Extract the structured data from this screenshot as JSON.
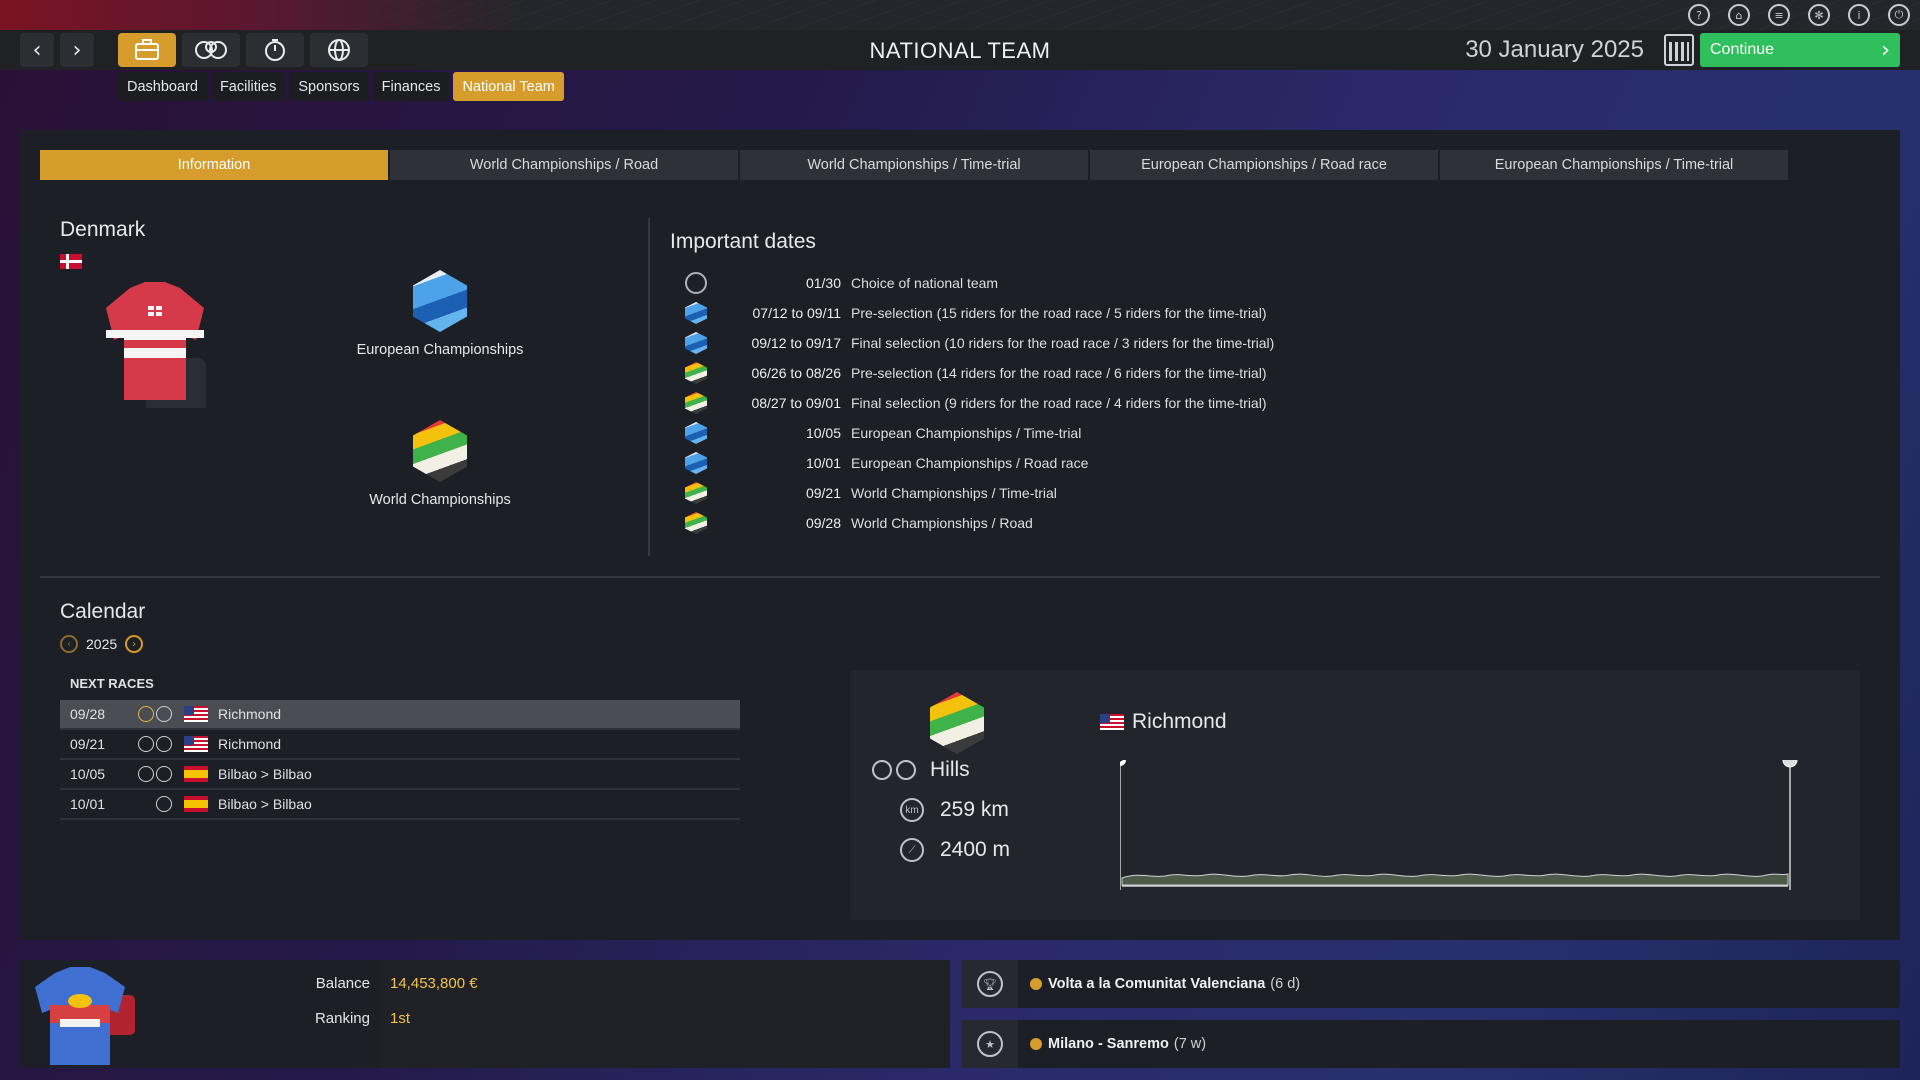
{
  "window": {
    "title": "NATIONAL TEAM",
    "date": "30 January 2025",
    "continue_label": "Continue"
  },
  "system_icons": [
    "help-icon",
    "home-icon",
    "menu-icon",
    "settings-icon",
    "info-icon",
    "power-icon"
  ],
  "nav_icons": [
    "back-arrow-icon",
    "forward-arrow-icon",
    "briefcase-icon",
    "team-icon",
    "stopwatch-icon",
    "globe-icon"
  ],
  "subtabs": [
    "Dashboard",
    "Facilities",
    "Sponsors",
    "Finances",
    "National Team"
  ],
  "active_subtab": "National Team",
  "content_tabs": [
    "Information",
    "World Championships / Road",
    "World Championships / Time-trial",
    "European Championships / Road race",
    "European Championships / Time-trial"
  ],
  "active_content_tab": "Information",
  "country": {
    "name": "Denmark"
  },
  "championships": {
    "european": "European Championships",
    "world": "World Championships"
  },
  "important_dates": {
    "title": "Important dates",
    "items": [
      {
        "icon": "clock",
        "date": "01/30",
        "label": "Choice of national team"
      },
      {
        "icon": "eu",
        "date": "07/12 to 09/11",
        "label": "Pre-selection (15 riders for the road race / 5 riders for the time-trial)"
      },
      {
        "icon": "eu",
        "date": "09/12 to 09/17",
        "label": "Final selection (10 riders for the road race / 3 riders for the time-trial)"
      },
      {
        "icon": "wc",
        "date": "06/26 to 08/26",
        "label": "Pre-selection (14 riders for the road race / 6 riders for the time-trial)"
      },
      {
        "icon": "wc",
        "date": "08/27 to 09/01",
        "label": "Final selection (9 riders for the road race / 4 riders for the time-trial)"
      },
      {
        "icon": "eu",
        "date": "10/05",
        "label": "European Championships / Time-trial"
      },
      {
        "icon": "eu",
        "date": "10/01",
        "label": "European Championships / Road race"
      },
      {
        "icon": "wc",
        "date": "09/21",
        "label": "World Championships / Time-trial"
      },
      {
        "icon": "wc",
        "date": "09/28",
        "label": "World Championships / Road"
      }
    ]
  },
  "calendar": {
    "title": "Calendar",
    "year": "2025",
    "next_races_label": "NEXT RACES",
    "races": [
      {
        "date": "09/28",
        "flag": "us",
        "name": "Richmond",
        "selected": true
      },
      {
        "date": "09/21",
        "flag": "us",
        "name": "Richmond",
        "selected": false
      },
      {
        "date": "10/05",
        "flag": "es",
        "name": "Bilbao > Bilbao",
        "selected": false
      },
      {
        "date": "10/01",
        "flag": "es",
        "name": "Bilbao > Bilbao",
        "selected": false
      }
    ]
  },
  "race_detail": {
    "name": "Richmond",
    "terrain": "Hills",
    "distance": "259 km",
    "elevation": "2400 m"
  },
  "team_summary": {
    "balance_label": "Balance",
    "balance": "14,453,800 €",
    "ranking_label": "Ranking",
    "ranking": "1st"
  },
  "upcoming_events": [
    {
      "icon": "trophy-icon",
      "name": "Volta a la Comunitat Valenciana",
      "duration": "(6 d)"
    },
    {
      "icon": "star-icon",
      "name": "Milano - Sanremo",
      "duration": "(7 w)"
    }
  ],
  "colors": {
    "accent": "#d69c2c",
    "continue": "#2fbf5c",
    "panel": "#1c1f25",
    "value": "#f2c24a"
  }
}
